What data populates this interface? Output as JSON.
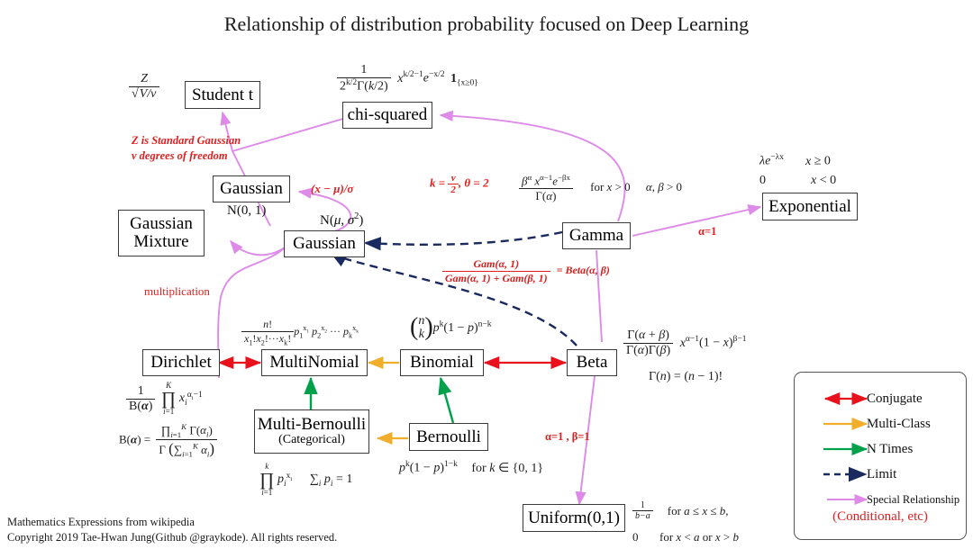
{
  "title": "Relationship of distribution probability focused on Deep Learning",
  "nodes": {
    "student_t": "Student t",
    "chi_squared": "chi-squared",
    "gaussian_std": "Gaussian",
    "gaussian_mixture_l1": "Gaussian",
    "gaussian_mixture_l2": "Mixture",
    "gaussian": "Gaussian",
    "gamma": "Gamma",
    "exponential": "Exponential",
    "dirichlet": "Dirichlet",
    "multinomial": "MultiNomial",
    "binomial": "Binomial",
    "beta": "Beta",
    "multi_bernoulli_l1": "Multi-Bernoulli",
    "multi_bernoulli_l2": "(Categorical)",
    "bernoulli": "Bernoulli",
    "uniform": "Uniform(0,1)"
  },
  "annotations": {
    "student_t_note_l1": "Z is Standard Gaussian",
    "student_t_note_l2": "v degrees of freedom",
    "z_over_sqrt": "Z / sqrt(V/v)",
    "chi_squared_pdf": "1 / (2^(k/2) Gamma(k/2)) x^(k/2-1) e^(-x/2) 1_{x>=0}",
    "k_theta": "k = v/2 , theta = 2",
    "standardize": "(x - mu)/sigma",
    "n01": "N(0, 1)",
    "nmusigma": "N(mu, sigma^2)",
    "multiplication": "multiplication",
    "gamma_pdf": "beta^alpha x^(alpha-1) e^(-beta x) / Gamma(alpha)",
    "gamma_cond": "for x > 0    alpha, beta > 0",
    "exp_pdf_l1": "lambda e^(-lambda x)    x >= 0",
    "exp_pdf_l2": "0    x < 0",
    "alpha_eq_1": "α=1",
    "gam_beta_identity": "Gam(alpha,1) / (Gam(alpha,1) + Gam(beta,1)) = Beta(alpha, beta)",
    "multinomial_pmf": "n! / (x1! x2! ... xk!) p1^x1 p2^x2 ... pk^xk",
    "binomial_pmf": "(n choose k) p^k (1-p)^(n-k)",
    "beta_pdf": "Gamma(alpha+beta)/(Gamma(alpha)Gamma(beta)) x^(alpha-1) (1-x)^(beta-1)",
    "gamma_factorial": "Gamma(n) = (n-1)!",
    "alpha_beta_1": "α=1 , β=1",
    "dirichlet_pdf": "1/B(alpha) prod_{i=1}^{K} xi^(alpha_i - 1)",
    "beta_function": "B(alpha) = prod Gamma(alpha_i) / Gamma(sum alpha_i)",
    "categorical_pmf": "prod_{i=1}^{k} pi^xi    sum_i pi = 1",
    "bernoulli_pmf": "p^k (1-p)^(1-k)   for k in {0,1}",
    "uniform_pdf_l1": "1/(b-a)   for a <= x <= b,",
    "uniform_pdf_l2": "0    for x < a or x > b"
  },
  "legend": {
    "items": [
      {
        "label": "Conjugate",
        "color": "#e8111c",
        "style": "double-arrow"
      },
      {
        "label": "Multi-Class",
        "color": "#f0ae2a",
        "style": "arrow"
      },
      {
        "label": "N Times",
        "color": "#00a14b",
        "style": "arrow"
      },
      {
        "label": "Limit",
        "color": "#1a2a5e",
        "style": "dashed-arrow"
      },
      {
        "label": "Special Relationship",
        "color": "#e08ae8",
        "style": "arrow"
      }
    ],
    "conditional_note": "(Conditional, etc)"
  },
  "footer": {
    "line1": "Mathematics Expressions from wikipedia",
    "line2": "Copyright 2019 Tae-Hwan Jung(Github @graykode). All rights reserved."
  },
  "colors": {
    "conjugate": "#e8111c",
    "multi_class": "#f0ae2a",
    "n_times": "#00a14b",
    "limit": "#1a2a5e",
    "special": "#e08ae8",
    "red_text": "#e02020"
  }
}
